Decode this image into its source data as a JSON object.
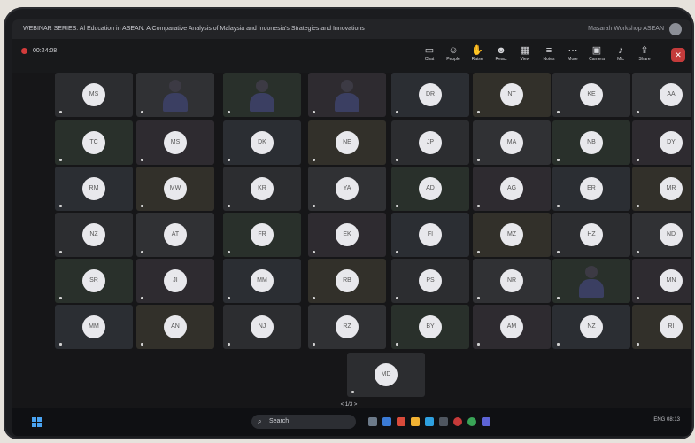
{
  "window": {
    "title": "WEBINAR SERIES: Al Education in ASEAN: A Comparative Analysis of Malaysia and Indonesia's Strategies and Innovations",
    "account": "Masarah Workshop ASEAN"
  },
  "meeting": {
    "timer": "00:24:08"
  },
  "toolbar": [
    {
      "icon": "chat-icon",
      "label": "Chat"
    },
    {
      "icon": "people-icon",
      "label": "People"
    },
    {
      "icon": "raise-hand-icon",
      "label": "Raise"
    },
    {
      "icon": "react-icon",
      "label": "React"
    },
    {
      "icon": "view-icon",
      "label": "View"
    },
    {
      "icon": "notes-icon",
      "label": "Notes"
    },
    {
      "icon": "more-icon",
      "label": "More"
    },
    {
      "icon": "camera-icon",
      "label": "Camera"
    },
    {
      "icon": "mic-icon",
      "label": "Mic"
    },
    {
      "icon": "share-icon",
      "label": "Share"
    }
  ],
  "tiles": [
    {
      "initials": "MS"
    },
    {
      "type": "video"
    },
    {
      "type": "video"
    },
    {
      "type": "video"
    },
    {
      "initials": "DR"
    },
    {
      "initials": "NT"
    },
    {
      "initials": "KE"
    },
    {
      "initials": "AA"
    },
    {
      "initials": "TC"
    },
    {
      "initials": "MS"
    },
    {
      "initials": "DK"
    },
    {
      "initials": "NE"
    },
    {
      "initials": "JP"
    },
    {
      "initials": "MA"
    },
    {
      "initials": "NB"
    },
    {
      "initials": "DY"
    },
    {
      "initials": "RM"
    },
    {
      "initials": "MW"
    },
    {
      "initials": "KR"
    },
    {
      "initials": "YA"
    },
    {
      "initials": "AD"
    },
    {
      "initials": "AG"
    },
    {
      "initials": "ER"
    },
    {
      "initials": "MR"
    },
    {
      "initials": "NZ"
    },
    {
      "initials": "AT"
    },
    {
      "initials": "FR"
    },
    {
      "initials": "EK"
    },
    {
      "initials": "FI"
    },
    {
      "initials": "MZ"
    },
    {
      "initials": "HZ"
    },
    {
      "initials": "ND"
    },
    {
      "initials": "SR"
    },
    {
      "initials": "JI"
    },
    {
      "initials": "MM"
    },
    {
      "initials": "RB"
    },
    {
      "initials": "PS"
    },
    {
      "initials": "NR"
    },
    {
      "type": "video"
    },
    {
      "initials": "MN"
    },
    {
      "initials": "MM"
    },
    {
      "initials": "AN"
    },
    {
      "initials": "NJ"
    },
    {
      "initials": "RZ"
    },
    {
      "initials": "BY"
    },
    {
      "initials": "AM"
    },
    {
      "initials": "NZ"
    },
    {
      "initials": "RI"
    },
    {
      "initials": "MD"
    }
  ],
  "pager": "< 1/3 >",
  "taskbar": {
    "search_label": "Search",
    "tray_text": "ENG  08:13"
  },
  "colors": {
    "accent": "#4aa4f2",
    "leave": "#c43b3b"
  }
}
